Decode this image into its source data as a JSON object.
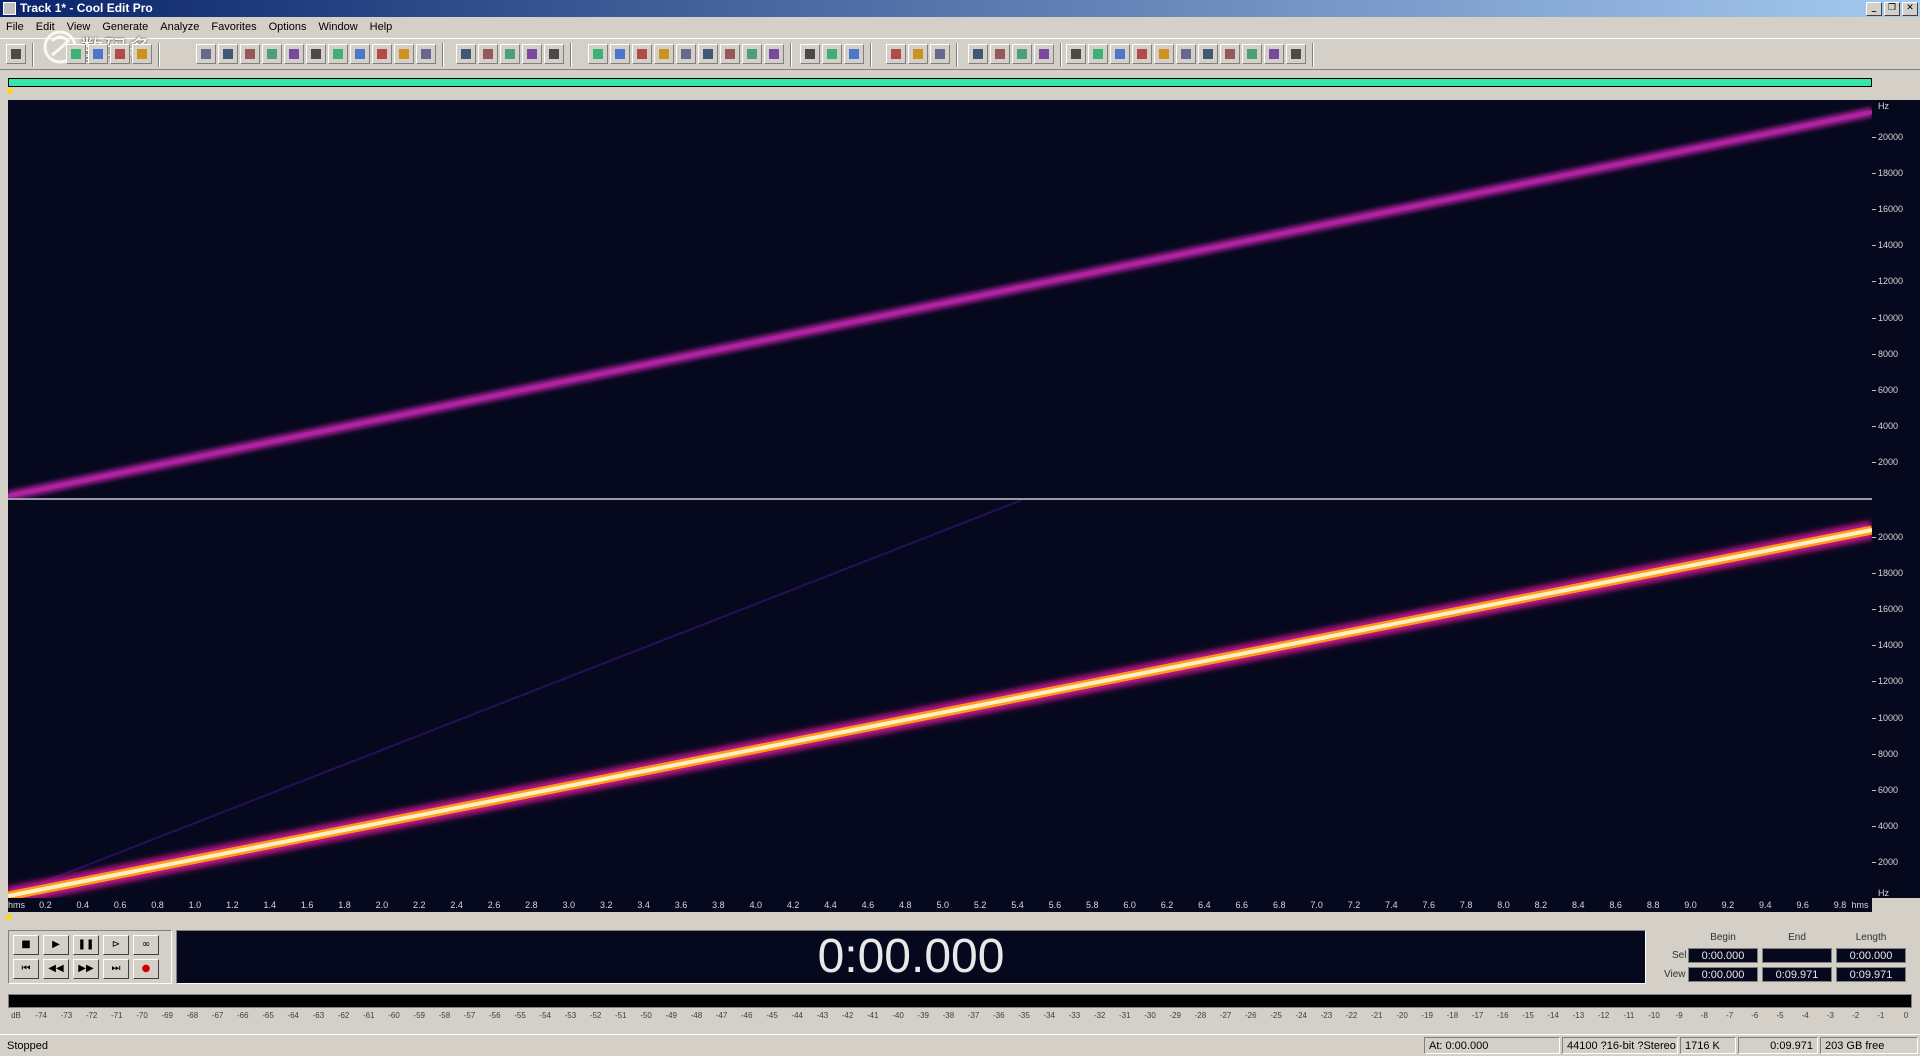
{
  "window": {
    "title": "Track 1* - Cool Edit Pro",
    "buttons": [
      "_",
      "❐",
      "✕"
    ]
  },
  "menu": {
    "items": [
      "File",
      "Edit",
      "View",
      "Generate",
      "Analyze",
      "Favorites",
      "Options",
      "Window",
      "Help"
    ]
  },
  "watermark": {
    "text": "数码多",
    "sub": "Soomal.com"
  },
  "hz_ruler": {
    "unit": "Hz",
    "labels": [
      "20000",
      "18000",
      "16000",
      "14000",
      "12000",
      "10000",
      "8000",
      "6000",
      "4000",
      "2000"
    ]
  },
  "time_ruler": {
    "first": "hms",
    "labels": [
      "0.2",
      "0.4",
      "0.6",
      "0.8",
      "1.0",
      "1.2",
      "1.4",
      "1.6",
      "1.8",
      "2.0",
      "2.2",
      "2.4",
      "2.6",
      "2.8",
      "3.0",
      "3.2",
      "3.4",
      "3.6",
      "3.8",
      "4.0",
      "4.2",
      "4.4",
      "4.6",
      "4.8",
      "5.0",
      "5.2",
      "5.4",
      "5.6",
      "5.8",
      "6.0",
      "6.2",
      "6.4",
      "6.6",
      "6.8",
      "7.0",
      "7.2",
      "7.4",
      "7.6",
      "7.8",
      "8.0",
      "8.2",
      "8.4",
      "8.6",
      "8.8",
      "9.0",
      "9.2",
      "9.4",
      "9.6",
      "9.8"
    ],
    "last": "hms"
  },
  "time_display": "0:00.000",
  "selection": {
    "headers": [
      "Begin",
      "End",
      "Length"
    ],
    "sel_label": "Sel",
    "view_label": "View",
    "sel": [
      "0:00.000",
      "",
      "0:00.000"
    ],
    "view": [
      "0:00.000",
      "0:09.971",
      "0:09.971"
    ]
  },
  "level_ruler": [
    "dB",
    "-74",
    "-73",
    "-72",
    "-71",
    "-70",
    "-69",
    "-68",
    "-67",
    "-66",
    "-65",
    "-64",
    "-63",
    "-62",
    "-61",
    "-60",
    "-59",
    "-58",
    "-57",
    "-56",
    "-55",
    "-54",
    "-53",
    "-52",
    "-51",
    "-50",
    "-49",
    "-48",
    "-47",
    "-46",
    "-45",
    "-44",
    "-43",
    "-42",
    "-41",
    "-40",
    "-39",
    "-38",
    "-37",
    "-36",
    "-35",
    "-34",
    "-33",
    "-32",
    "-31",
    "-30",
    "-29",
    "-28",
    "-27",
    "-26",
    "-25",
    "-24",
    "-23",
    "-22",
    "-21",
    "-20",
    "-19",
    "-18",
    "-17",
    "-16",
    "-15",
    "-14",
    "-13",
    "-12",
    "-11",
    "-10",
    "-9",
    "-8",
    "-7",
    "-6",
    "-5",
    "-4",
    "-3",
    "-2",
    "-1",
    "0"
  ],
  "status": {
    "state": "Stopped",
    "at": "At: 0:00.000",
    "format": "44100 ?16-bit ?Stereo",
    "size": "1716 K",
    "length": "0:09.971",
    "free": "203 GB free"
  },
  "colors": {
    "background": "#06091d",
    "ch1_sweep": "#9b1b92",
    "ch2_sweep": "#fff1c0",
    "overview": "#35e8a8"
  },
  "icons": [
    "transport-stop-icon",
    "transport-play-icon",
    "transport-pause-icon",
    "transport-play-to-end-icon",
    "transport-loop-icon",
    "go-start-icon",
    "rewind-icon",
    "fast-forward-icon",
    "go-end-icon",
    "record-icon"
  ]
}
